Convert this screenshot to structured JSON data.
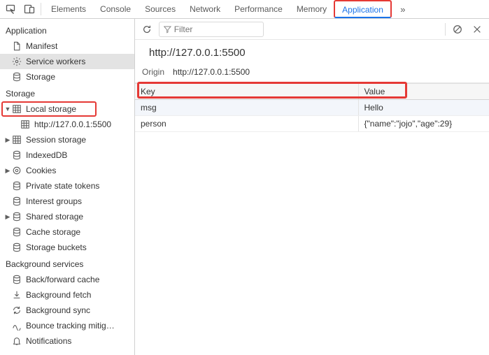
{
  "tabs": {
    "items": [
      "Elements",
      "Console",
      "Sources",
      "Network",
      "Performance",
      "Memory",
      "Application"
    ],
    "activeIndex": 6,
    "more": "»"
  },
  "sidebar": {
    "sections": [
      {
        "title": "Application",
        "items": [
          {
            "icon": "doc",
            "label": "Manifest",
            "expandable": false
          },
          {
            "icon": "gear",
            "label": "Service workers",
            "expandable": false,
            "selected": true
          },
          {
            "icon": "db",
            "label": "Storage",
            "expandable": false
          }
        ]
      },
      {
        "title": "Storage",
        "items": [
          {
            "icon": "grid",
            "label": "Local storage",
            "expandable": true,
            "expanded": true,
            "highlight": true,
            "children": [
              {
                "icon": "grid",
                "label": "http://127.0.0.1:5500"
              }
            ]
          },
          {
            "icon": "grid",
            "label": "Session storage",
            "expandable": true
          },
          {
            "icon": "db",
            "label": "IndexedDB",
            "expandable": false
          },
          {
            "icon": "ring",
            "label": "Cookies",
            "expandable": true
          },
          {
            "icon": "db",
            "label": "Private state tokens",
            "expandable": false
          },
          {
            "icon": "db",
            "label": "Interest groups",
            "expandable": false
          },
          {
            "icon": "db",
            "label": "Shared storage",
            "expandable": true
          },
          {
            "icon": "db",
            "label": "Cache storage",
            "expandable": false
          },
          {
            "icon": "db",
            "label": "Storage buckets",
            "expandable": false
          }
        ]
      },
      {
        "title": "Background services",
        "items": [
          {
            "icon": "db",
            "label": "Back/forward cache",
            "expandable": false
          },
          {
            "icon": "fetch",
            "label": "Background fetch",
            "expandable": false
          },
          {
            "icon": "sync",
            "label": "Background sync",
            "expandable": false
          },
          {
            "icon": "bounce",
            "label": "Bounce tracking mitig…",
            "expandable": false
          },
          {
            "icon": "bell",
            "label": "Notifications",
            "expandable": false
          }
        ]
      }
    ]
  },
  "toolbar": {
    "filterPlaceholder": "Filter"
  },
  "main": {
    "url": "http://127.0.0.1:5500",
    "originLabel": "Origin",
    "origin": "http://127.0.0.1:5500"
  },
  "table": {
    "headers": [
      "Key",
      "Value"
    ],
    "rows": [
      {
        "key": "msg",
        "value": "Hello"
      },
      {
        "key": "person",
        "value": "{\"name\":\"jojo\",\"age\":29}"
      }
    ]
  }
}
